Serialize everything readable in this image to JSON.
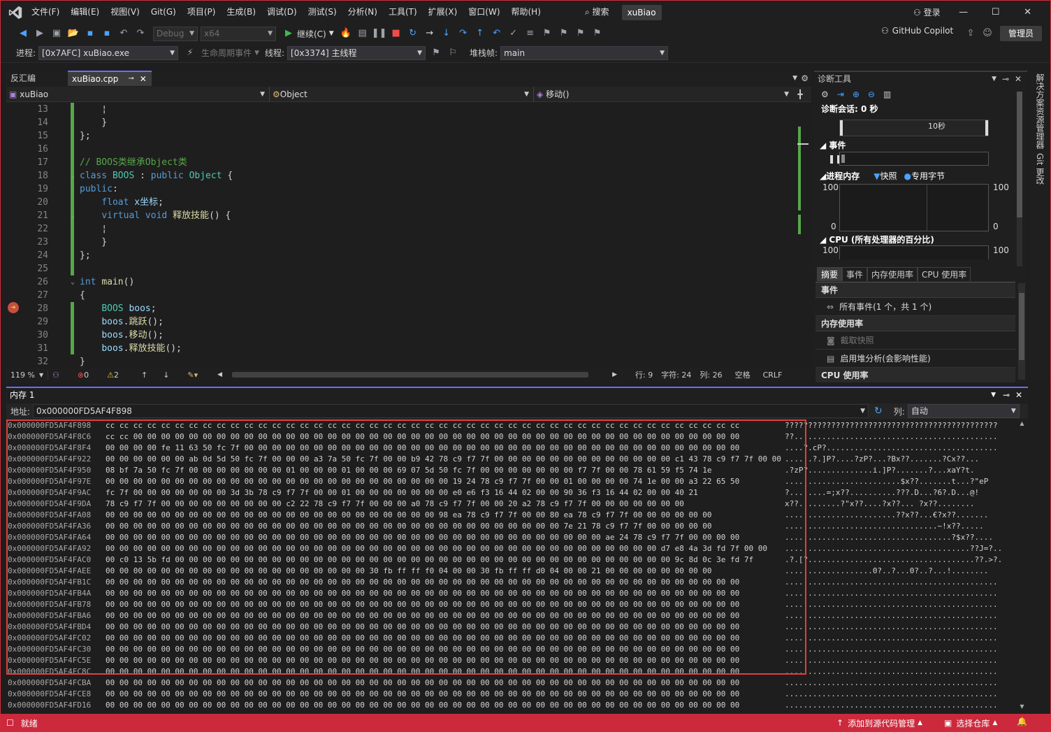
{
  "menu": [
    "文件(F)",
    "编辑(E)",
    "视图(V)",
    "Git(G)",
    "项目(P)",
    "生成(B)",
    "调试(D)",
    "测试(S)",
    "分析(N)",
    "工具(T)",
    "扩展(X)",
    "窗口(W)",
    "帮助(H)"
  ],
  "search_label": "搜索",
  "project_name": "xuBiao",
  "signin": "登录",
  "toolbar": {
    "config": "Debug",
    "platform": "x64",
    "continue": "继续(C)",
    "copilot": "GitHub Copilot",
    "admin": "管理员"
  },
  "debugbar": {
    "process_label": "进程:",
    "process": "[0x7AFC] xuBiao.exe",
    "lifecycle": "生命周期事件",
    "thread_label": "线程:",
    "thread": "[0x3374] 主线程",
    "stackframe_label": "堆栈帧:",
    "stackframe": "main"
  },
  "doc_tabs": [
    {
      "label": "反汇编",
      "active": false
    },
    {
      "label": "xuBiao.cpp",
      "active": true
    }
  ],
  "nav": {
    "project": "xuBiao",
    "scope": "Object",
    "member": "移动()"
  },
  "code_lines": [
    {
      "n": "13",
      "t": [
        [
          "pl",
          "    ¦"
        ]
      ]
    },
    {
      "n": "14",
      "t": [
        [
          "pl",
          "    }"
        ]
      ]
    },
    {
      "n": "15",
      "t": [
        [
          "pl",
          "};"
        ]
      ]
    },
    {
      "n": "16",
      "t": []
    },
    {
      "n": "17",
      "t": [
        [
          "cm",
          "// BOOS类继承Object类"
        ]
      ]
    },
    {
      "n": "18",
      "t": [
        [
          "kw",
          "class "
        ],
        [
          "ty",
          "BOOS"
        ],
        [
          "pl",
          " : "
        ],
        [
          "kw",
          "public "
        ],
        [
          "ty",
          "Object"
        ],
        [
          "pl",
          " {"
        ]
      ]
    },
    {
      "n": "19",
      "t": [
        [
          "kw",
          "public"
        ],
        [
          "pl",
          ":"
        ]
      ]
    },
    {
      "n": "20",
      "t": [
        [
          "pl",
          "    "
        ],
        [
          "kw",
          "float "
        ],
        [
          "vr",
          "x坐标"
        ],
        [
          "pl",
          ";"
        ]
      ]
    },
    {
      "n": "21",
      "t": [
        [
          "pl",
          "    "
        ],
        [
          "kw",
          "virtual void "
        ],
        [
          "fn",
          "释放技能"
        ],
        [
          "pl",
          "() {"
        ]
      ]
    },
    {
      "n": "22",
      "t": [
        [
          "pl",
          "    ¦"
        ]
      ]
    },
    {
      "n": "23",
      "t": [
        [
          "pl",
          "    }"
        ]
      ]
    },
    {
      "n": "24",
      "t": [
        [
          "pl",
          "};"
        ]
      ]
    },
    {
      "n": "25",
      "t": []
    },
    {
      "n": "26",
      "t": [
        [
          "kw",
          "int "
        ],
        [
          "fn",
          "main"
        ],
        [
          "pl",
          "()"
        ]
      ]
    },
    {
      "n": "27",
      "t": [
        [
          "pl",
          "{"
        ]
      ]
    },
    {
      "n": "28",
      "t": [
        [
          "pl",
          "    "
        ],
        [
          "ty",
          "BOOS "
        ],
        [
          "vr",
          "boos"
        ],
        [
          "pl",
          ";"
        ]
      ]
    },
    {
      "n": "29",
      "t": [
        [
          "pl",
          "    "
        ],
        [
          "vr",
          "boos"
        ],
        [
          "pl",
          "."
        ],
        [
          "fn",
          "跳跃"
        ],
        [
          "pl",
          "();"
        ]
      ]
    },
    {
      "n": "30",
      "t": [
        [
          "pl",
          "    "
        ],
        [
          "vr",
          "boos"
        ],
        [
          "pl",
          "."
        ],
        [
          "fn",
          "移动"
        ],
        [
          "pl",
          "();"
        ]
      ]
    },
    {
      "n": "31",
      "t": [
        [
          "pl",
          "    "
        ],
        [
          "vr",
          "boos"
        ],
        [
          "pl",
          "."
        ],
        [
          "fn",
          "释放技能"
        ],
        [
          "pl",
          "();"
        ]
      ]
    },
    {
      "n": "32",
      "t": [
        [
          "pl",
          "}"
        ]
      ]
    }
  ],
  "editor_status": {
    "zoom": "119 %",
    "errors": "0",
    "warnings": "2",
    "line": "行: 9",
    "char": "字符: 24",
    "col": "列: 26",
    "ws": "空格",
    "eol": "CRLF"
  },
  "diag": {
    "title": "诊断工具",
    "session": "诊断会话: 0 秒",
    "tick": "10秒",
    "events": "事件",
    "memory": "进程内存",
    "snapshot": "快照",
    "private_bytes": "专用字节",
    "mem_max": "100",
    "mem_min": "0",
    "cpu": "CPU (所有处理器的百分比)",
    "cpu_max": "100",
    "tabs": [
      "摘要",
      "事件",
      "内存使用率",
      "CPU 使用率"
    ],
    "sec_events": "事件",
    "all_events": "所有事件(1 个，共 1 个)",
    "sec_mem": "内存使用率",
    "take_snapshot": "截取快照",
    "heap": "启用堆分析(会影响性能)",
    "sec_cpu": "CPU 使用率"
  },
  "side": {
    "solution": "解决方案资源管理器",
    "git": "Git 更改"
  },
  "memory": {
    "title": "内存 1",
    "addr_label": "地址:",
    "address": "0x000000FD5AF4F898",
    "col_label": "列:",
    "col_value": "自动",
    "rows": [
      {
        "a": "0x000000FD5AF4F898",
        "h": "cc cc cc cc cc cc cc cc cc cc cc cc cc cc cc cc cc cc cc cc cc cc cc cc cc cc cc cc cc cc cc cc cc cc cc cc cc cc cc cc cc cc cc cc cc cc",
        "s": "??????????????????????????????????????????????"
      },
      {
        "a": "0x000000FD5AF4F8C6",
        "h": "cc cc 00 00 00 00 00 00 00 00 00 00 00 00 00 00 00 00 00 00 00 00 00 00 00 00 00 00 00 00 00 00 00 00 00 00 00 00 00 00 00 00 00 00 00 00",
        "s": "??............................................"
      },
      {
        "a": "0x000000FD5AF4F8F4",
        "h": "00 00 00 00 fe 11 63 50 fc 7f 00 00 00 00 00 00 00 00 00 00 00 00 00 00 00 00 00 00 00 00 00 00 00 00 00 00 00 00 00 00 00 00 00 00 00 00",
        "s": "....?.cP?....................................."
      },
      {
        "a": "0x000000FD5AF4F922",
        "h": "00 00 00 00 00 00 ab 0d 5d 50 fc 7f 00 00 00 a3 7a 50 fc 7f 00 00 b9 42 78 c9 f7 7f 00 00 00 00 00 00 00 00 00 00 00 00 00 c1 43 78 c9 f7 7f 00 00",
        "s": "......?.]P?....?zP?...?Bx??.......?Cx??..."
      },
      {
        "a": "0x000000FD5AF4F950",
        "h": "08 bf 7a 50 fc 7f 00 00 00 00 00 00 00 01 00 00 00 01 00 00 00 69 07 5d 50 fc 7f 00 00 00 00 00 00 00 f7 7f 00 00 78 61 59 f5 74 1e",
        "s": ".?zP?..............i.]P?.......?...xaY?t."
      },
      {
        "a": "0x000000FD5AF4F97E",
        "h": "00 00 00 00 00 00 00 00 00 00 00 00 00 00 00 00 00 00 00 00 00 00 00 00 00 19 24 78 c9 f7 7f 00 00 01 00 00 00 00 74 1e 00 00 a3 22 65 50",
        "s": ".........................$x??.......t...?\"eP"
      },
      {
        "a": "0x000000FD5AF4F9AC",
        "h": "fc 7f 00 00 00 00 00 00 00 3d 3b 78 c9 f7 7f 00 00 01 00 00 00 00 00 00 00 e0 e6 f3 16 44 02 00 00 90 36 f3 16 44 02 00 00 40 21",
        "s": "?........=;x??..........???.D...?6?.D...@!"
      },
      {
        "a": "0x000000FD5AF4F9DA",
        "h": "78 c9 f7 7f 00 00 00 00 00 00 00 00 00 c2 22 78 c9 f7 7f 00 00 00 a0 78 c9 f7 7f 00 00 20 a2 78 c9 f7 7f 00 00 00 00 00 00 00",
        "s": "x??.........?\"x??....?x??... ?x??........"
      },
      {
        "a": "0x000000FD5AF4FA08",
        "h": "00 00 00 00 00 00 00 00 00 00 00 00 00 00 00 00 00 00 00 00 00 00 00 00 98 ea 78 c9 f7 7f 00 00 80 ea 78 c9 f7 7f 00 00 00 00 00 00",
        "s": "........................??x??...€?x??......."
      },
      {
        "a": "0x000000FD5AF4FA36",
        "h": "00 00 00 00 00 00 00 00 00 00 00 00 00 00 00 00 00 00 00 00 00 00 00 00 00 00 00 00 00 00 00 00 00 7e 21 78 c9 f7 7f 00 00 00 00 00",
        "s": ".................................~!x??....."
      },
      {
        "a": "0x000000FD5AF4FA64",
        "h": "00 00 00 00 00 00 00 00 00 00 00 00 00 00 00 00 00 00 00 00 00 00 00 00 00 00 00 00 00 00 00 00 00 00 00 00 ae 24 78 c9 f7 7f 00 00 00 00",
        "s": "....................................?$x??...."
      },
      {
        "a": "0x000000FD5AF4FA92",
        "h": "00 00 00 00 00 00 00 00 00 00 00 00 00 00 00 00 00 00 00 00 00 00 00 00 00 00 00 00 00 00 00 00 00 00 00 00 00 00 00 00 d7 e8 4a 3d fd 7f 00 00",
        "s": "........................................??J=?.."
      },
      {
        "a": "0x000000FD5AF4FAC0",
        "h": "00 c0 13 5b fd 00 00 00 00 00 00 00 00 00 00 00 00 00 00 00 00 00 00 00 00 00 00 00 00 00 00 00 00 00 00 00 00 00 00 00 00 9c 8d 0c 3e fd 7f",
        "s": ".?.[?....................................??.>?."
      },
      {
        "a": "0x000000FD5AF4FAEE",
        "h": "00 00 00 00 00 00 00 00 00 00 00 00 00 00 00 00 00 00 00 30 fb ff ff f0 04 00 00 30 fb ff ff d0 04 00 00 21 00 00 00 00 00 00 00 00",
        "s": "...................0?..?...0?..?...!........"
      },
      {
        "a": "0x000000FD5AF4FB1C",
        "h": "00 00 00 00 00 00 00 00 00 00 00 00 00 00 00 00 00 00 00 00 00 00 00 00 00 00 00 00 00 00 00 00 00 00 00 00 00 00 00 00 00 00 00 00 00 00",
        "s": ".............................................."
      },
      {
        "a": "0x000000FD5AF4FB4A",
        "h": "00 00 00 00 00 00 00 00 00 00 00 00 00 00 00 00 00 00 00 00 00 00 00 00 00 00 00 00 00 00 00 00 00 00 00 00 00 00 00 00 00 00 00 00 00 00",
        "s": ".............................................."
      },
      {
        "a": "0x000000FD5AF4FB78",
        "h": "00 00 00 00 00 00 00 00 00 00 00 00 00 00 00 00 00 00 00 00 00 00 00 00 00 00 00 00 00 00 00 00 00 00 00 00 00 00 00 00 00 00 00 00 00 00",
        "s": ".............................................."
      },
      {
        "a": "0x000000FD5AF4FBA6",
        "h": "00 00 00 00 00 00 00 00 00 00 00 00 00 00 00 00 00 00 00 00 00 00 00 00 00 00 00 00 00 00 00 00 00 00 00 00 00 00 00 00 00 00 00 00 00 00",
        "s": ".............................................."
      },
      {
        "a": "0x000000FD5AF4FBD4",
        "h": "00 00 00 00 00 00 00 00 00 00 00 00 00 00 00 00 00 00 00 00 00 00 00 00 00 00 00 00 00 00 00 00 00 00 00 00 00 00 00 00 00 00 00 00 00 00",
        "s": ".............................................."
      },
      {
        "a": "0x000000FD5AF4FC02",
        "h": "00 00 00 00 00 00 00 00 00 00 00 00 00 00 00 00 00 00 00 00 00 00 00 00 00 00 00 00 00 00 00 00 00 00 00 00 00 00 00 00 00 00 00 00 00 00",
        "s": ".............................................."
      },
      {
        "a": "0x000000FD5AF4FC30",
        "h": "00 00 00 00 00 00 00 00 00 00 00 00 00 00 00 00 00 00 00 00 00 00 00 00 00 00 00 00 00 00 00 00 00 00 00 00 00 00 00 00 00 00 00 00 00 00",
        "s": ".............................................."
      },
      {
        "a": "0x000000FD5AF4FC5E",
        "h": "00 00 00 00 00 00 00 00 00 00 00 00 00 00 00 00 00 00 00 00 00 00 00 00 00 00 00 00 00 00 00 00 00 00 00 00 00 00 00 00 00 00 00 00 00 00",
        "s": ".............................................."
      },
      {
        "a": "0x000000FD5AF4FC8C",
        "h": "00 00 00 00 00 00 00 00 00 00 00 00 00 00 00 00 00 00 00 00 00 00 00 00 00 00 00 00 00 00 00 00 00 00 00 00 00 00 00 00 00 00 00 00 00 00",
        "s": ".............................................."
      },
      {
        "a": "0x000000FD5AF4FCBA",
        "h": "00 00 00 00 00 00 00 00 00 00 00 00 00 00 00 00 00 00 00 00 00 00 00 00 00 00 00 00 00 00 00 00 00 00 00 00 00 00 00 00 00 00 00 00 00 00",
        "s": ".............................................."
      },
      {
        "a": "0x000000FD5AF4FCE8",
        "h": "00 00 00 00 00 00 00 00 00 00 00 00 00 00 00 00 00 00 00 00 00 00 00 00 00 00 00 00 00 00 00 00 00 00 00 00 00 00 00 00 00 00 00 00 00 00",
        "s": ".............................................."
      },
      {
        "a": "0x000000FD5AF4FD16",
        "h": "00 00 00 00 00 00 00 00 00 00 00 00 00 00 00 00 00 00 00 00 00 00 00 00 00 00 00 00 00 00 00 00 00 00 00 00 00 00 00 00 00 00 00 00 00 00",
        "s": ".............................................."
      }
    ]
  },
  "status": {
    "ready": "就绪",
    "add_source": "添加到源代码管理",
    "select_repo": "选择仓库"
  },
  "colors": {
    "accent": "#6c6cff",
    "status_bar": "#cc293d",
    "highlight_box": "#e04040"
  }
}
